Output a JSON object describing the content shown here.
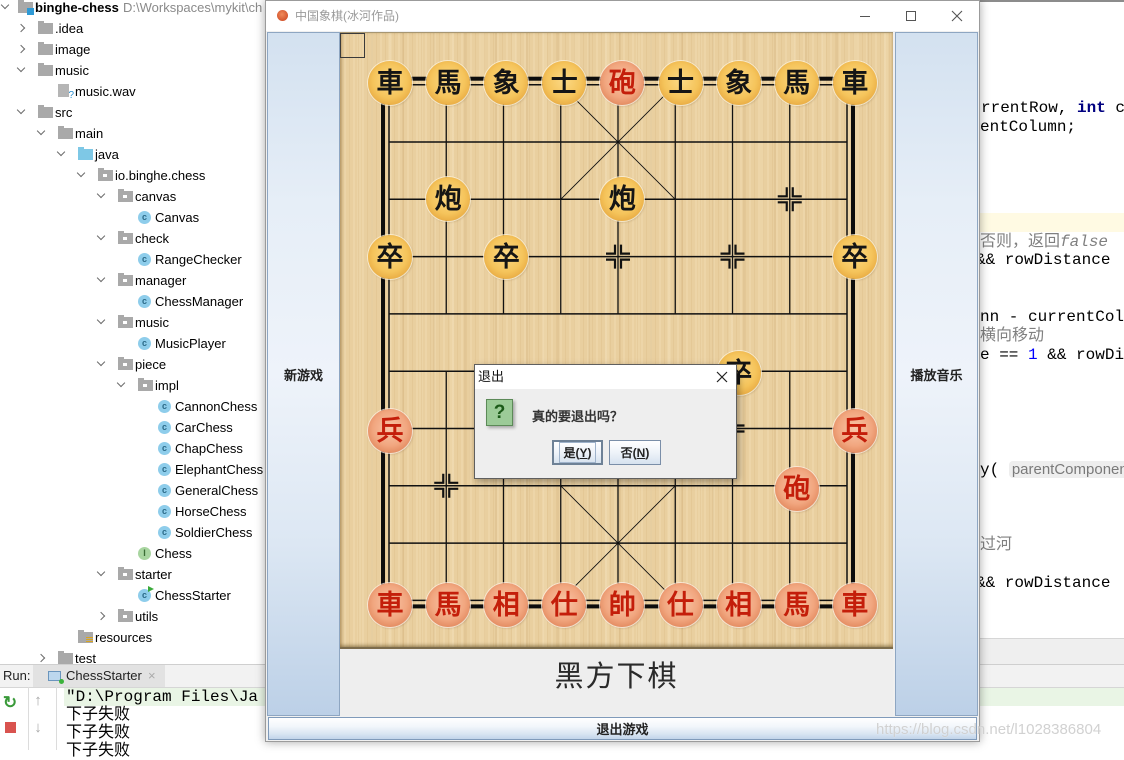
{
  "ide": {
    "project_tree": [
      {
        "label": "binghe-chess",
        "level": 0,
        "type": "module",
        "arrow": "down",
        "path": "D:\\Workspaces\\mykit\\ch"
      },
      {
        "label": ".idea",
        "level": 1,
        "type": "folder",
        "arrow": "right"
      },
      {
        "label": "image",
        "level": 1,
        "type": "folder",
        "arrow": "right"
      },
      {
        "label": "music",
        "level": 1,
        "type": "folder",
        "arrow": "down"
      },
      {
        "label": "music.wav",
        "level": 2,
        "type": "unknown-file"
      },
      {
        "label": "src",
        "level": 1,
        "type": "folder",
        "arrow": "down"
      },
      {
        "label": "main",
        "level": 2,
        "type": "folder",
        "arrow": "down"
      },
      {
        "label": "java",
        "level": 3,
        "type": "source-folder",
        "arrow": "down"
      },
      {
        "label": "io.binghe.chess",
        "level": 4,
        "type": "package",
        "arrow": "down"
      },
      {
        "label": "canvas",
        "level": 5,
        "type": "package",
        "arrow": "down"
      },
      {
        "label": "Canvas",
        "level": 6,
        "type": "class"
      },
      {
        "label": "check",
        "level": 5,
        "type": "package",
        "arrow": "down"
      },
      {
        "label": "RangeChecker",
        "level": 6,
        "type": "class"
      },
      {
        "label": "manager",
        "level": 5,
        "type": "package",
        "arrow": "down"
      },
      {
        "label": "ChessManager",
        "level": 6,
        "type": "class"
      },
      {
        "label": "music",
        "level": 5,
        "type": "package",
        "arrow": "down"
      },
      {
        "label": "MusicPlayer",
        "level": 6,
        "type": "class"
      },
      {
        "label": "piece",
        "level": 5,
        "type": "package",
        "arrow": "down"
      },
      {
        "label": "impl",
        "level": 6,
        "type": "package",
        "arrow": "down"
      },
      {
        "label": "CannonChess",
        "level": 7,
        "type": "class"
      },
      {
        "label": "CarChess",
        "level": 7,
        "type": "class"
      },
      {
        "label": "ChapChess",
        "level": 7,
        "type": "class"
      },
      {
        "label": "ElephantChess",
        "level": 7,
        "type": "class"
      },
      {
        "label": "GeneralChess",
        "level": 7,
        "type": "class"
      },
      {
        "label": "HorseChess",
        "level": 7,
        "type": "class"
      },
      {
        "label": "SoldierChess",
        "level": 7,
        "type": "class"
      },
      {
        "label": "Chess",
        "level": 6,
        "type": "interface"
      },
      {
        "label": "starter",
        "level": 5,
        "type": "package",
        "arrow": "down"
      },
      {
        "label": "ChessStarter",
        "level": 6,
        "type": "runnable-class"
      },
      {
        "label": "utils",
        "level": 5,
        "type": "package",
        "arrow": "right"
      },
      {
        "label": "resources",
        "level": 3,
        "type": "resources-folder"
      },
      {
        "label": "test",
        "level": 2,
        "type": "folder",
        "arrow": "right"
      }
    ],
    "icon_glyphs": {
      "class": "c",
      "runnable-class": "c",
      "interface": "I"
    }
  },
  "editor": {
    "lines": [
      {
        "segments": [
          {
            "text": "rrentRow, ",
            "style": "plain"
          },
          {
            "text": "int",
            "style": "keyword"
          },
          {
            "text": " c",
            "style": "plain"
          }
        ]
      },
      {
        "segments": [
          {
            "text": "entColumn;",
            "style": "plain"
          }
        ]
      },
      {
        "segments": [
          {
            "text": "否则，返回",
            "style": "comment"
          },
          {
            "text": "false",
            "style": "comment-italic"
          }
        ]
      },
      {
        "segments": [
          {
            "text": "&& rowDistance",
            "style": "plain"
          }
        ]
      },
      {
        "segments": [
          {
            "text": "nn - currentCol",
            "style": "plain"
          }
        ]
      },
      {
        "segments": [
          {
            "text": "横向移动",
            "style": "comment"
          }
        ]
      },
      {
        "segments": [
          {
            "text": "e == ",
            "style": "plain"
          },
          {
            "text": "1",
            "style": "number"
          },
          {
            "text": " && rowDi",
            "style": "plain"
          }
        ]
      },
      {
        "segments": [
          {
            "text": "y( ",
            "style": "plain"
          },
          {
            "text": "parentComponen",
            "style": "hint"
          }
        ]
      },
      {
        "segments": [
          {
            "text": "过河",
            "style": "comment"
          }
        ]
      },
      {
        "segments": [
          {
            "text": "&& rowDistance",
            "style": "plain"
          }
        ]
      }
    ]
  },
  "run_panel": {
    "label": "Run:",
    "tab_label": "ChessStarter",
    "tab_close": "×",
    "tools": {
      "rerun": "↻",
      "up": "↑",
      "down": "↓"
    },
    "console_lines": [
      "\"D:\\Program Files\\Ja",
      "下子失败",
      "下子失败",
      "下子失败"
    ]
  },
  "chess_window": {
    "title": "中国象棋(冰河作品)",
    "new_game_label": "新游戏",
    "play_music_label": "播放音乐",
    "status_text": "黑方下棋",
    "exit_label": "退出游戏"
  },
  "board": {
    "pieces": [
      {
        "side": "black",
        "name": "chariot",
        "char": "車",
        "row": 0,
        "col": 0
      },
      {
        "side": "black",
        "name": "horse",
        "char": "馬",
        "row": 0,
        "col": 1
      },
      {
        "side": "black",
        "name": "elephant",
        "char": "象",
        "row": 0,
        "col": 2
      },
      {
        "side": "black",
        "name": "advisor",
        "char": "士",
        "row": 0,
        "col": 3
      },
      {
        "side": "red",
        "name": "cannon",
        "char": "砲",
        "row": 0,
        "col": 4
      },
      {
        "side": "black",
        "name": "advisor",
        "char": "士",
        "row": 0,
        "col": 5
      },
      {
        "side": "black",
        "name": "elephant",
        "char": "象",
        "row": 0,
        "col": 6
      },
      {
        "side": "black",
        "name": "horse",
        "char": "馬",
        "row": 0,
        "col": 7
      },
      {
        "side": "black",
        "name": "chariot",
        "char": "車",
        "row": 0,
        "col": 8
      },
      {
        "side": "black",
        "name": "cannon",
        "char": "炮",
        "row": 2,
        "col": 1
      },
      {
        "side": "black",
        "name": "cannon",
        "char": "炮",
        "row": 2,
        "col": 4
      },
      {
        "side": "black",
        "name": "soldier",
        "char": "卒",
        "row": 3,
        "col": 0
      },
      {
        "side": "black",
        "name": "soldier",
        "char": "卒",
        "row": 3,
        "col": 2
      },
      {
        "side": "black",
        "name": "soldier",
        "char": "卒",
        "row": 3,
        "col": 8
      },
      {
        "side": "black",
        "name": "soldier",
        "char": "卒",
        "row": 5,
        "col": 6
      },
      {
        "side": "red",
        "name": "soldier",
        "char": "兵",
        "row": 6,
        "col": 0
      },
      {
        "side": "red",
        "name": "soldier",
        "char": "兵",
        "row": 6,
        "col": 8
      },
      {
        "side": "red",
        "name": "cannon",
        "char": "砲",
        "row": 7,
        "col": 7
      },
      {
        "side": "red",
        "name": "chariot",
        "char": "車",
        "row": 9,
        "col": 0
      },
      {
        "side": "red",
        "name": "horse",
        "char": "馬",
        "row": 9,
        "col": 1
      },
      {
        "side": "red",
        "name": "elephant",
        "char": "相",
        "row": 9,
        "col": 2
      },
      {
        "side": "red",
        "name": "advisor",
        "char": "仕",
        "row": 9,
        "col": 3
      },
      {
        "side": "red",
        "name": "general",
        "char": "帥",
        "row": 9,
        "col": 4
      },
      {
        "side": "red",
        "name": "advisor",
        "char": "仕",
        "row": 9,
        "col": 5
      },
      {
        "side": "red",
        "name": "elephant",
        "char": "相",
        "row": 9,
        "col": 6
      },
      {
        "side": "red",
        "name": "horse",
        "char": "馬",
        "row": 9,
        "col": 7
      },
      {
        "side": "red",
        "name": "chariot",
        "char": "車",
        "row": 9,
        "col": 8
      }
    ]
  },
  "dialog": {
    "title": "退出",
    "icon_glyph": "?",
    "message": "真的要退出吗？",
    "yes_button": {
      "prefix": "是(",
      "mnemonic": "Y",
      "suffix": ")"
    },
    "no_button": {
      "prefix": "否(",
      "mnemonic": "N",
      "suffix": ")"
    }
  },
  "watermark": "https://blog.csdn.net/l1028386804"
}
